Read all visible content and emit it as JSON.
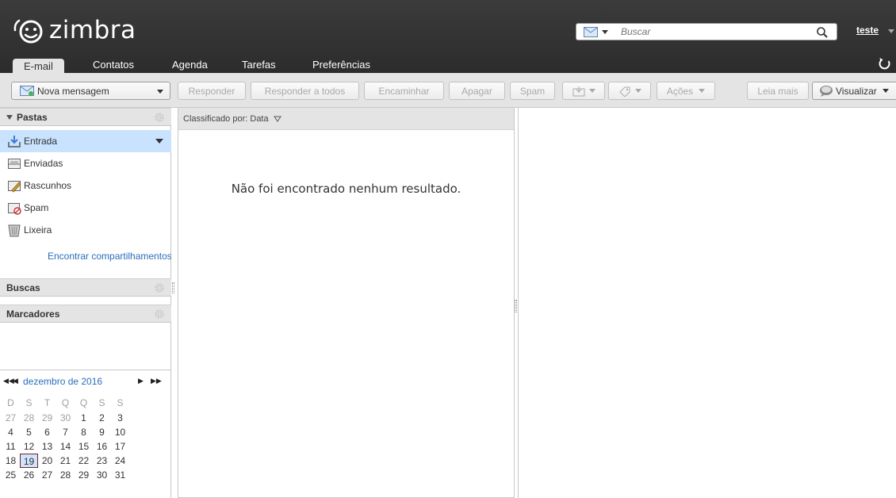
{
  "app": {
    "logo_text": "zimbra"
  },
  "search": {
    "placeholder": "Buscar",
    "type_icon": "mail-icon"
  },
  "user": {
    "name": "teste"
  },
  "tabs": [
    {
      "label": "E-mail",
      "active": true
    },
    {
      "label": "Contatos"
    },
    {
      "label": "Agenda"
    },
    {
      "label": "Tarefas"
    },
    {
      "label": "Preferências"
    }
  ],
  "toolbar": {
    "new_message": "Nova mensagem",
    "reply": "Responder",
    "reply_all": "Responder a todos",
    "forward": "Encaminhar",
    "delete": "Apagar",
    "spam": "Spam",
    "actions": "Ações",
    "read_more": "Leia mais",
    "view": "Visualizar"
  },
  "sidebar": {
    "folders_title": "Pastas",
    "folders": [
      {
        "label": "Entrada",
        "icon": "inbox-icon",
        "selected": true
      },
      {
        "label": "Enviadas",
        "icon": "sent-icon"
      },
      {
        "label": "Rascunhos",
        "icon": "drafts-icon"
      },
      {
        "label": "Spam",
        "icon": "spam-icon"
      },
      {
        "label": "Lixeira",
        "icon": "trash-icon"
      }
    ],
    "share_link": "Encontrar compartilhamentos",
    "searches_title": "Buscas",
    "tags_title": "Marcadores"
  },
  "calendar": {
    "title": "dezembro de 2016",
    "weekdays": [
      "D",
      "S",
      "T",
      "Q",
      "Q",
      "S",
      "S"
    ],
    "weeks": [
      [
        "27",
        "28",
        "29",
        "30",
        "1",
        "2",
        "3"
      ],
      [
        "4",
        "5",
        "6",
        "7",
        "8",
        "9",
        "10"
      ],
      [
        "11",
        "12",
        "13",
        "14",
        "15",
        "16",
        "17"
      ],
      [
        "18",
        "19",
        "20",
        "21",
        "22",
        "23",
        "24"
      ],
      [
        "25",
        "26",
        "27",
        "28",
        "29",
        "30",
        "31"
      ]
    ],
    "today": "19"
  },
  "list": {
    "sort_label": "Classificado por: Data",
    "empty_message": "Não foi encontrado nenhum resultado."
  },
  "colors": {
    "header_bg": "#2f2f2f",
    "toolbar_bg": "#e4e4e4",
    "selection": "#c9e3ff",
    "link": "#2a6ebb"
  }
}
